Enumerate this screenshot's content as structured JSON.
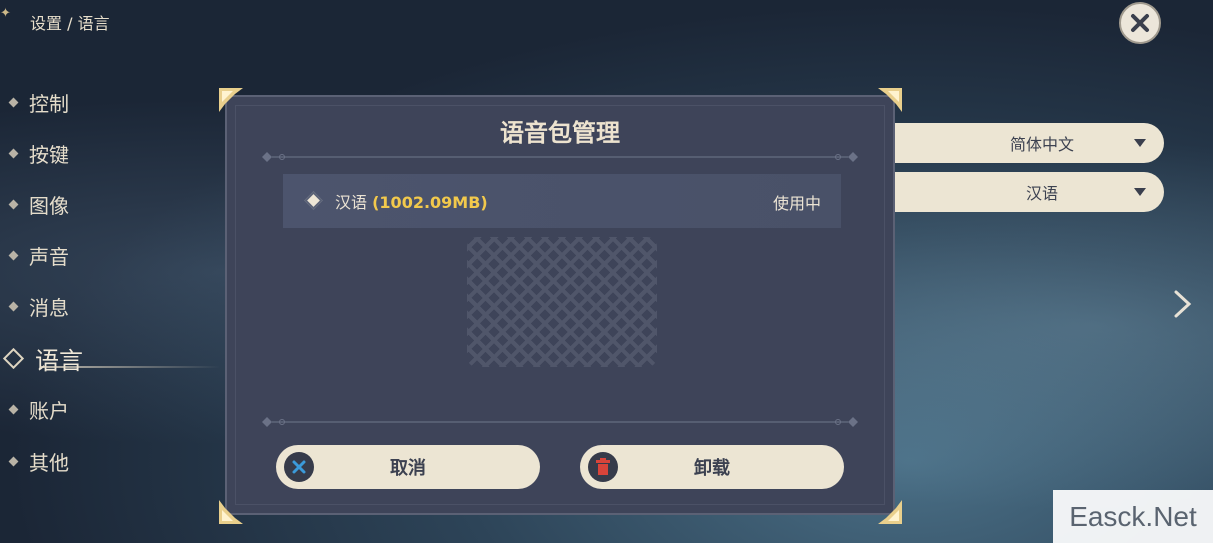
{
  "breadcrumb": "设置 / 语言",
  "sidebar": {
    "items": [
      {
        "label": "控制"
      },
      {
        "label": "按键"
      },
      {
        "label": "图像"
      },
      {
        "label": "声音"
      },
      {
        "label": "消息"
      },
      {
        "label": "语言",
        "active": true
      },
      {
        "label": "账户"
      },
      {
        "label": "其他"
      }
    ]
  },
  "settings": {
    "text_language": "简体中文",
    "voice_language": "汉语"
  },
  "dialog": {
    "title": "语音包管理",
    "packs": [
      {
        "name": "汉语",
        "size": "(1002.09MB)",
        "status": "使用中"
      }
    ],
    "cancel_label": "取消",
    "uninstall_label": "卸载"
  },
  "watermark": "Easck.Net",
  "icons": [
    "close-icon",
    "chevron-right-icon",
    "cancel-x-icon",
    "trash-icon"
  ],
  "colors": {
    "accent_gold": "#f2c94c",
    "panel": "#3e4459",
    "button_bg": "#ece5d3",
    "delete_red": "#d9443a",
    "cancel_blue": "#3b9ad9"
  }
}
